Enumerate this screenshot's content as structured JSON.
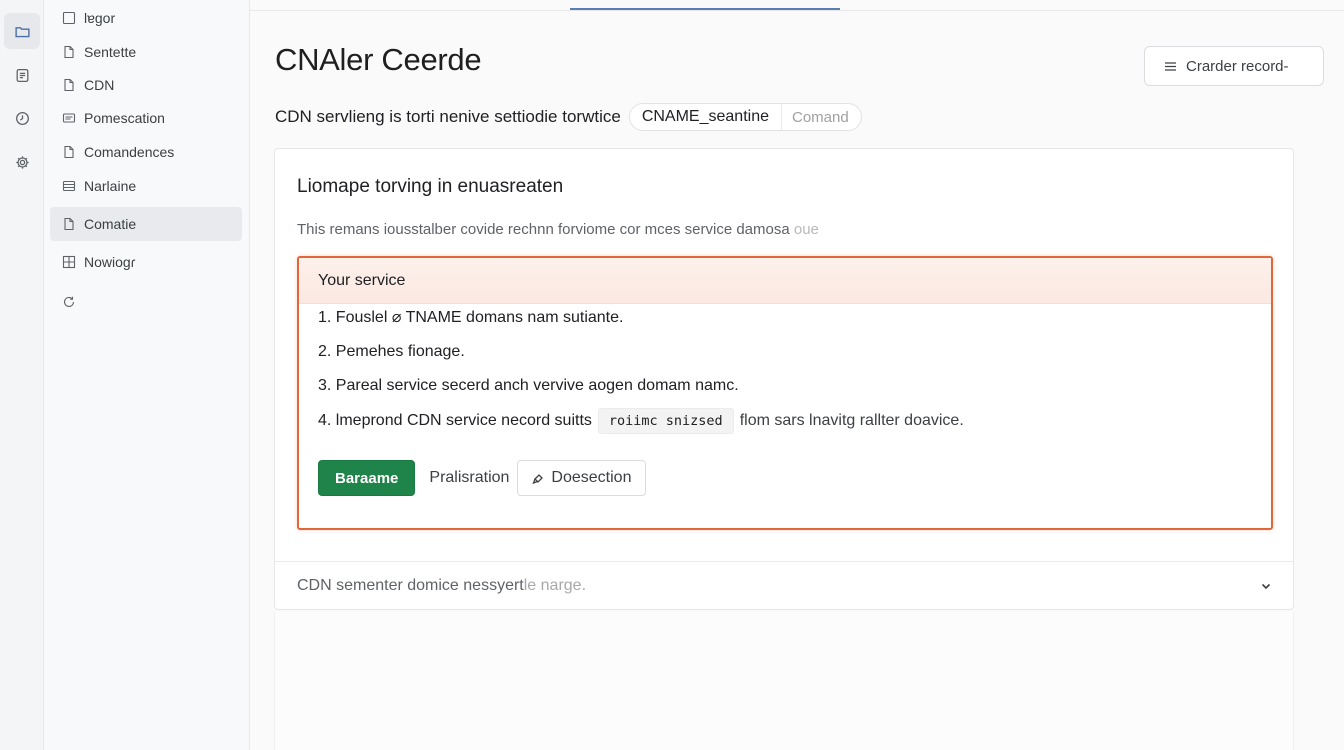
{
  "rail": {
    "items": [
      {
        "icon": "folder-icon",
        "active": true
      },
      {
        "icon": "document-icon",
        "active": false
      },
      {
        "icon": "clock-icon",
        "active": false
      },
      {
        "icon": "gear-icon",
        "active": false
      }
    ]
  },
  "sidebar": {
    "items": [
      {
        "label": "lɐgor",
        "icon": "checkbox-icon",
        "active": false
      },
      {
        "label": "Sentette",
        "icon": "file-icon",
        "active": false
      },
      {
        "label": "CDN",
        "icon": "file-icon",
        "active": false
      },
      {
        "label": "Pomescation",
        "icon": "card-icon",
        "active": false
      },
      {
        "label": "Comandences",
        "icon": "file-icon",
        "active": false
      },
      {
        "label": "Narlaine",
        "icon": "list-icon",
        "active": false
      },
      {
        "label": "Comatie",
        "icon": "file-icon",
        "active": true
      },
      {
        "label": "Nowiogɾ",
        "icon": "grid-icon",
        "active": false
      },
      {
        "label": "",
        "icon": "refresh-icon",
        "active": false
      }
    ]
  },
  "header": {
    "title": "CNAler Ceerde",
    "order_button_label": "Crarder record-",
    "subtitle": "CDN servlieng is torti nenive settiodie torwtice",
    "chip_main": "CNAME_seantine",
    "chip_sub": "Comand"
  },
  "card": {
    "title": "Liomape torving in enuasreaten",
    "description": "This remans iousstalber covide rechnn forviome cor mces service damosa",
    "description_fade": "oue",
    "callout": {
      "title": "Your service",
      "steps": [
        {
          "text": "1. Fouslel ⌀ TNAME domans nam sutiante."
        },
        {
          "text": "2. Pemehes fionage."
        },
        {
          "text": "3. Pareal service secerd anch vervive aogen domam namc."
        },
        {
          "text": "4. lmeprond CDN service necord suitts",
          "code": "roiimc snizsed",
          "tail": "flom  sars lnavitg rallter doavice."
        }
      ],
      "primary_button": "Baraame",
      "link_button": "Pralisration",
      "outline_button": "Doesection"
    },
    "accordion_label": "CDN sementer domice nessyert",
    "accordion_label_fade": "le narge."
  },
  "colors": {
    "accent_green": "#1e8449",
    "callout_border": "#e0673a",
    "tab_underline": "#5b7fb4"
  }
}
